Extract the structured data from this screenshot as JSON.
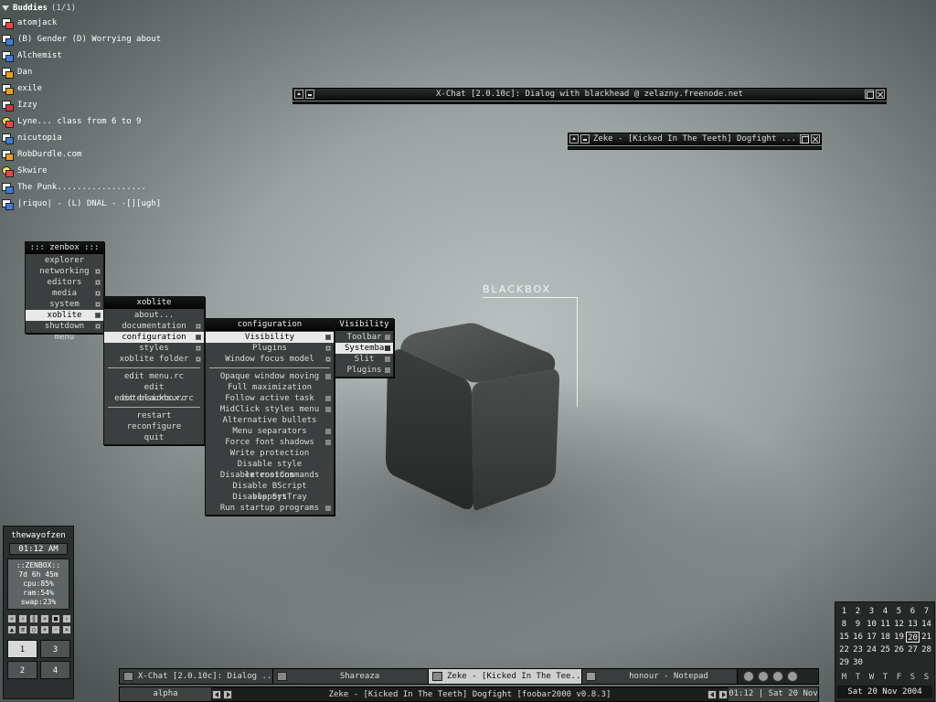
{
  "buddies": {
    "header": "Buddies",
    "count": "(1/1)",
    "items": [
      {
        "name": "atomjack",
        "icon": "buddy-icon"
      },
      {
        "name": "(B) Gender (D) Worrying about",
        "icon": "msn-icon"
      },
      {
        "name": "Alchemist",
        "icon": "msn-icon"
      },
      {
        "name": "Dan",
        "icon": "yahoo-icon"
      },
      {
        "name": "exile",
        "icon": "yahoo-icon"
      },
      {
        "name": "Izzy",
        "icon": "away-icon"
      },
      {
        "name": "Lyne... class from 6 to 9",
        "icon": "aim-icon"
      },
      {
        "name": "nicutopia",
        "icon": "msn-icon"
      },
      {
        "name": "RobDurdle.com",
        "icon": "yahoo-icon"
      },
      {
        "name": "Skwire",
        "icon": "aim-icon"
      },
      {
        "name": "The Punk..................",
        "icon": "msn-icon"
      },
      {
        "name": "|riquo| - (L) DNAL - -[][ugh]",
        "icon": "msn-icon"
      }
    ]
  },
  "windows": {
    "xchat": {
      "title": "X-Chat [2.0.10c]: Dialog with blackhead @ zelazny.freenode.net"
    },
    "foobar": {
      "title": "Zeke - [Kicked In The Teeth] Dogfight ..."
    }
  },
  "menus": {
    "zenbox": {
      "title": "::: zenbox :::",
      "items": [
        "explorer",
        "networking",
        "editors",
        "media",
        "system",
        "xoblite",
        "shutdown menu"
      ]
    },
    "xoblite": {
      "title": "xoblite",
      "items": [
        "about...",
        "documentation",
        "configuration",
        "styles",
        "xoblite folder",
        "edit menu.rc",
        "edit extensions.rc",
        "edit blackbox.rc",
        "restart",
        "reconfigure",
        "quit"
      ]
    },
    "configuration": {
      "title": "configuration",
      "items": [
        "Visibility",
        "Plugins",
        "Window focus model",
        "Opaque window moving",
        "Full maximization",
        "Follow active task",
        "MidClick styles menu",
        "Alternative bullets",
        "Menu separators",
        "Force font shadows",
        "Write protection",
        "Disable style extensions",
        "Disable rootCommands",
        "Disable BScript support",
        "Disable SysTray",
        "Run startup programs"
      ]
    },
    "visibility": {
      "title": "Visibility",
      "items": [
        "Toolbar",
        "Systembar",
        "Slit",
        "Plugins"
      ]
    }
  },
  "logo": {
    "text": "BLACKBOX"
  },
  "slit": {
    "name": "thewayofzen",
    "clock": "01:12 AM",
    "stats": [
      "::ZENBOX::",
      "7d 6h 45m",
      "cpu:85%",
      "ram:54%",
      "swap:23%"
    ],
    "desktops": [
      "1",
      "3",
      "2",
      "4"
    ]
  },
  "calendar": {
    "rows": [
      [
        "1",
        "2",
        "3",
        "4",
        "5",
        "6",
        "7"
      ],
      [
        "8",
        "9",
        "10",
        "11",
        "12",
        "13",
        "14"
      ],
      [
        "15",
        "16",
        "17",
        "18",
        "19",
        "20",
        "21"
      ],
      [
        "22",
        "23",
        "24",
        "25",
        "26",
        "27",
        "28"
      ],
      [
        "29",
        "30",
        "",
        "",
        "",
        "",
        ""
      ]
    ],
    "today": "20",
    "weekdays": [
      "M",
      "T",
      "W",
      "T",
      "F",
      "S",
      "S"
    ],
    "date": "Sat 20 Nov 2004"
  },
  "taskbar": {
    "tasks": [
      {
        "label": "X-Chat [2.0.10c]: Dialog ..."
      },
      {
        "label": "Shareaza"
      },
      {
        "label": "Zeke - [Kicked In The Tee..."
      },
      {
        "label": "honour - Notepad"
      }
    ]
  },
  "toolbar": {
    "workspace": "alpha",
    "window_title": "Zeke - [Kicked In The Teeth] Dogfight     [foobar2000 v0.8.3]",
    "clock": "01:12 | Sat 20 Nov"
  }
}
